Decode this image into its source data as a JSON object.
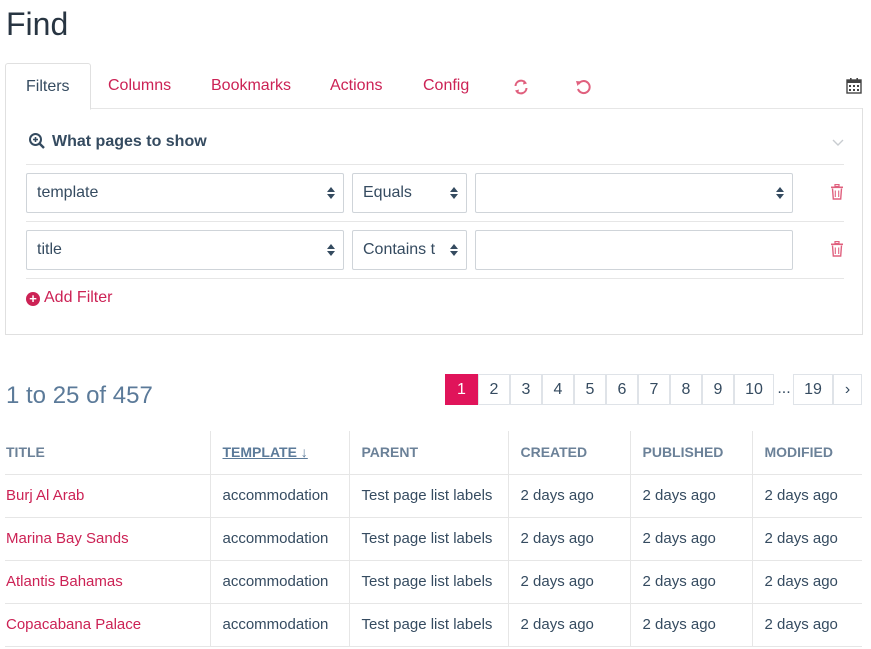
{
  "page": {
    "title": "Find"
  },
  "tabs": {
    "filters": "Filters",
    "columns": "Columns",
    "bookmarks": "Bookmarks",
    "actions": "Actions",
    "config": "Config",
    "refresh_icon": "refresh-icon",
    "reset_icon": "undo-icon",
    "calendar_icon": "calendar-icon"
  },
  "filters": {
    "heading": "What pages to show",
    "rows": [
      {
        "field": "template",
        "operator": "Equals",
        "value": ""
      },
      {
        "field": "title",
        "operator": "Contains t",
        "value": ""
      }
    ],
    "add_label": "Add Filter"
  },
  "results": {
    "summary": "1 to 25 of 457",
    "pages": [
      "1",
      "2",
      "3",
      "4",
      "5",
      "6",
      "7",
      "8",
      "9",
      "10"
    ],
    "current_page": "1",
    "ellipsis": "...",
    "last_page": "19",
    "next": "›"
  },
  "table": {
    "headers": [
      "TITLE",
      "TEMPLATE ↓",
      "PARENT",
      "CREATED",
      "PUBLISHED",
      "MODIFIED"
    ],
    "rows": [
      [
        "Burj Al Arab",
        "accommodation",
        "Test page list labels",
        "2 days ago",
        "2 days ago",
        "2 days ago"
      ],
      [
        "Marina Bay Sands",
        "accommodation",
        "Test page list labels",
        "2 days ago",
        "2 days ago",
        "2 days ago"
      ],
      [
        "Atlantis Bahamas",
        "accommodation",
        "Test page list labels",
        "2 days ago",
        "2 days ago",
        "2 days ago"
      ],
      [
        "Copacabana Palace",
        "accommodation",
        "Test page list labels",
        "2 days ago",
        "2 days ago",
        "2 days ago"
      ]
    ]
  },
  "colors": {
    "accent": "#cc2255",
    "active_page": "#e0145a",
    "text": "#354b60"
  }
}
